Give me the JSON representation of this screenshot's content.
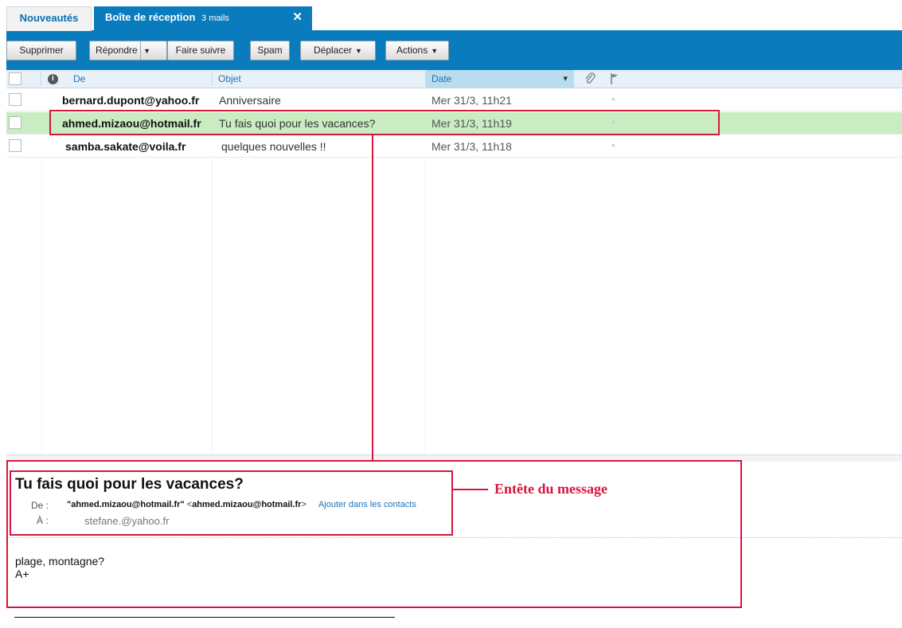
{
  "tabs": {
    "news_label": "Nouveautés",
    "inbox_label": "Boîte de réception",
    "inbox_count": "3 mails",
    "close_glyph": "✕"
  },
  "toolbar": {
    "delete": "Supprimer",
    "reply": "Répondre",
    "forward": "Faire suivre",
    "spam": "Spam",
    "move": "Déplacer",
    "actions": "Actions",
    "caret": "▼"
  },
  "columns": {
    "info_icon": "info-icon",
    "from": "De",
    "subject": "Objet",
    "date": "Date",
    "sort_caret": "▾",
    "attachment_icon": "paperclip-icon",
    "flag_icon": "flag-icon"
  },
  "messages": [
    {
      "from": "bernard.dupont@yahoo.fr",
      "subject": "Anniversaire",
      "date": "Mer 31/3, 11h21",
      "selected": false
    },
    {
      "from": "ahmed.mizaou@hotmail.fr",
      "subject": "Tu fais quoi pour les vacances?",
      "date": "Mer 31/3, 11h19",
      "selected": true
    },
    {
      "from": "samba.sakate@voila.fr",
      "subject": "quelques nouvelles !!",
      "date": "Mer 31/3, 11h18",
      "selected": false
    }
  ],
  "reading": {
    "title": "Tu fais quoi pour les vacances?",
    "from_label": "De :",
    "from_name": "\"ahmed.mizaou@hotmail.fr\"",
    "from_lt": "<",
    "from_email": "ahmed.mizaou@hotmail.fr",
    "from_gt": ">",
    "add_contact": "Ajouter dans les contacts",
    "to_label": "À :",
    "to_value": "stefane.@yahoo.fr",
    "body_line1": "plage, montagne?",
    "body_line2": "A+"
  },
  "annotation": {
    "label": "Entête du message"
  },
  "colors": {
    "accent": "#0a7cbd",
    "selected_row": "#c9ecc1",
    "annotation": "#d6163e"
  }
}
